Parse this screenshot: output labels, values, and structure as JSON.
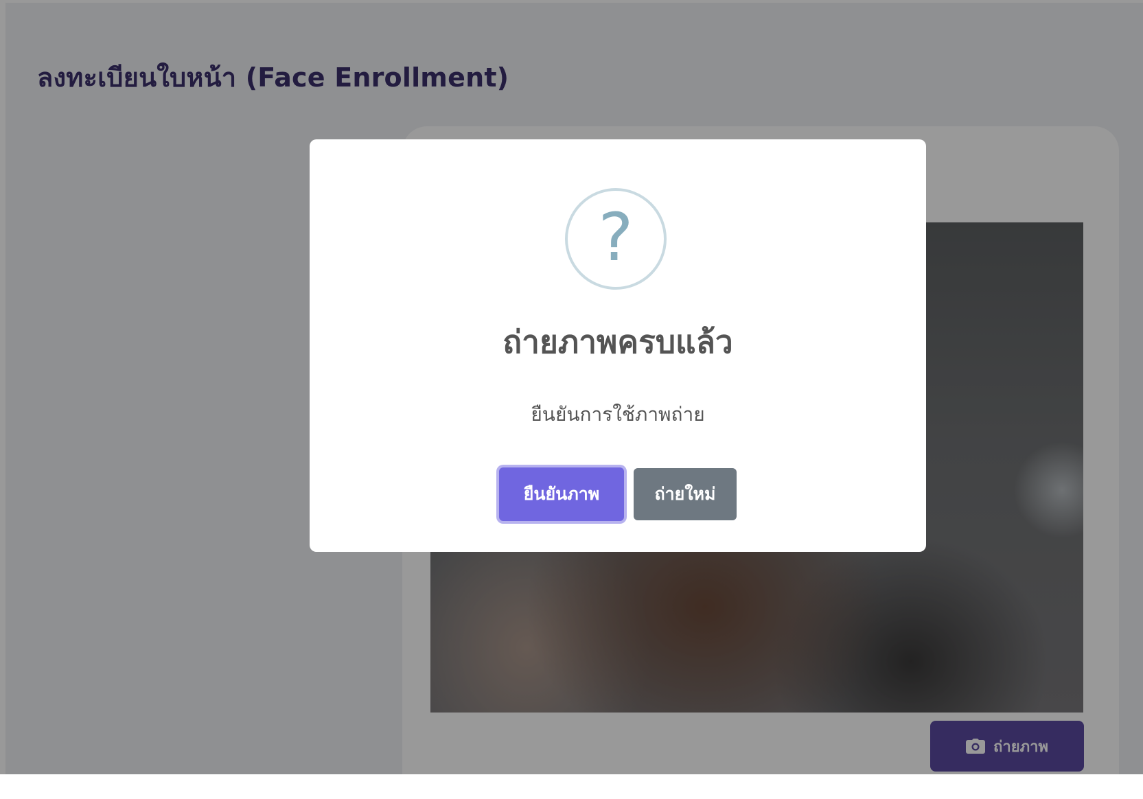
{
  "page": {
    "title": "ลงทะเบียนใบหน้า (Face Enrollment)"
  },
  "camera": {
    "capture_label": "ถ่ายภาพ",
    "capture_icon": "camera-icon"
  },
  "dialog": {
    "icon": "question-icon",
    "icon_glyph": "?",
    "title": "ถ่ายภาพครบแล้ว",
    "text": "ยืนยันการใช้ภาพถ่าย",
    "confirm_label": "ยืนยันภาพ",
    "retake_label": "ถ่ายใหม่"
  },
  "colors": {
    "page_title": "#3b2f6b",
    "confirm_button": "#7066e0",
    "retake_button": "#6e7881",
    "capture_button": "#5b4aa0",
    "question_icon": "#87adbd"
  }
}
